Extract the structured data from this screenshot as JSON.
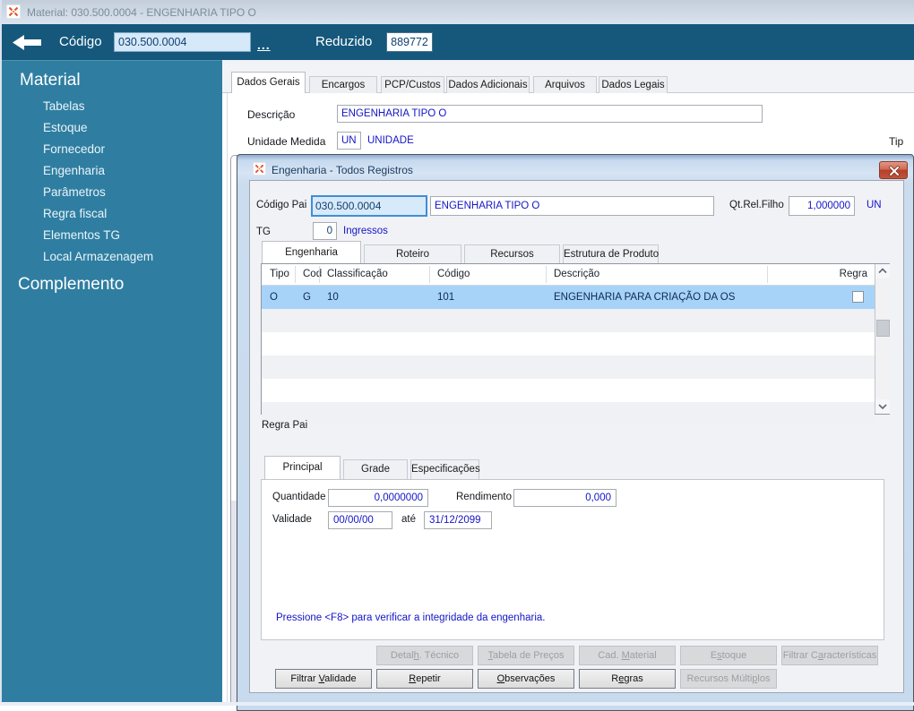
{
  "window": {
    "title": "Material: 030.500.0004 - ENGENHARIA TIPO O"
  },
  "header": {
    "codigo_label": "Código",
    "codigo_value": "030.500.0004",
    "more_label": "...",
    "reduzido_label": "Reduzido",
    "reduzido_value": "889772"
  },
  "sidebar": {
    "heading": "Material",
    "items": [
      "Tabelas",
      "Estoque",
      "Fornecedor",
      "Engenharia",
      "Parâmetros",
      "Regra fiscal",
      "Elementos TG",
      "Local Armazenagem"
    ],
    "footer_heading": "Complemento"
  },
  "main": {
    "tabs": [
      {
        "label": "Dados Gerais",
        "active": true
      },
      {
        "label": "Encargos",
        "active": false
      },
      {
        "label": "PCP/Custos",
        "active": false
      },
      {
        "label": "Dados Adicionais",
        "active": false
      },
      {
        "label": "Arquivos",
        "active": false
      },
      {
        "label": "Dados Legais",
        "active": false
      }
    ],
    "descricao_label": "Descrição",
    "descricao_value": "ENGENHARIA TIPO O",
    "unidade_label": "Unidade Medida",
    "unidade_value": "UN",
    "unidade_desc": "UNIDADE",
    "tipo_label_truncated": "Tip"
  },
  "modal": {
    "title": "Engenharia - Todos Registros",
    "codigo_pai_label": "Código Pai",
    "codigo_pai_value": "030.500.0004",
    "descricao_value": "ENGENHARIA TIPO O",
    "qt_rel_filho_label": "Qt.Rel.Filho",
    "qt_rel_filho_value": "1,000000",
    "qt_rel_filho_unit": "UN",
    "tg_label": "TG",
    "tg_value": "0",
    "tg_desc": "Ingressos",
    "tabs": [
      {
        "label": "Engenharia",
        "active": true
      },
      {
        "label": "Roteiro",
        "active": false
      },
      {
        "label": "Recursos",
        "active": false
      },
      {
        "label": "Estrutura de Produto",
        "active": false
      }
    ],
    "grid": {
      "columns": [
        "Tipo",
        "Cod",
        "Classificação",
        "Código",
        "Descrição",
        "Regra"
      ],
      "rows": [
        {
          "tipo": "O",
          "cod": "G",
          "classificacao": "10",
          "codigo": "101",
          "descricao": "ENGENHARIA PARA CRIAÇÃO DA OS",
          "regra": false
        }
      ]
    },
    "regra_pai_label": "Regra Pai",
    "inner_tabs": [
      {
        "label": "Principal",
        "active": true
      },
      {
        "label": "Grade",
        "active": false
      },
      {
        "label": "Especificações",
        "active": false
      }
    ],
    "fields": {
      "quantidade_label": "Quantidade",
      "quantidade_value": "0,0000000",
      "rendimento_label": "Rendimento",
      "rendimento_value": "0,000",
      "validade_label": "Validade",
      "validade_inicio": "00/00/00",
      "ate_label": "até",
      "validade_fim": "31/12/2099"
    },
    "f8_message": "Pressione <F8> para verificar a integridade da engenharia.",
    "buttons_row1": [
      {
        "label": "Detalh. Técnico",
        "u": 5,
        "enabled": false
      },
      {
        "label": "Tabela de Preços",
        "u": 0,
        "enabled": false
      },
      {
        "label": "Cad. Material",
        "u": 5,
        "enabled": false
      },
      {
        "label": "Estoque",
        "u": 1,
        "enabled": false
      },
      {
        "label": "Filtrar Características",
        "u": 9,
        "enabled": false
      }
    ],
    "buttons_row2": [
      {
        "label": "Filtrar Validade",
        "u": 8,
        "enabled": true
      },
      {
        "label": "Repetir",
        "u": 0,
        "enabled": true
      },
      {
        "label": "Observações",
        "u": 0,
        "enabled": true
      },
      {
        "label": "Regras",
        "u": 1,
        "enabled": true
      },
      {
        "label": "Recursos Múltiplos",
        "u": 14,
        "enabled": false
      }
    ]
  }
}
